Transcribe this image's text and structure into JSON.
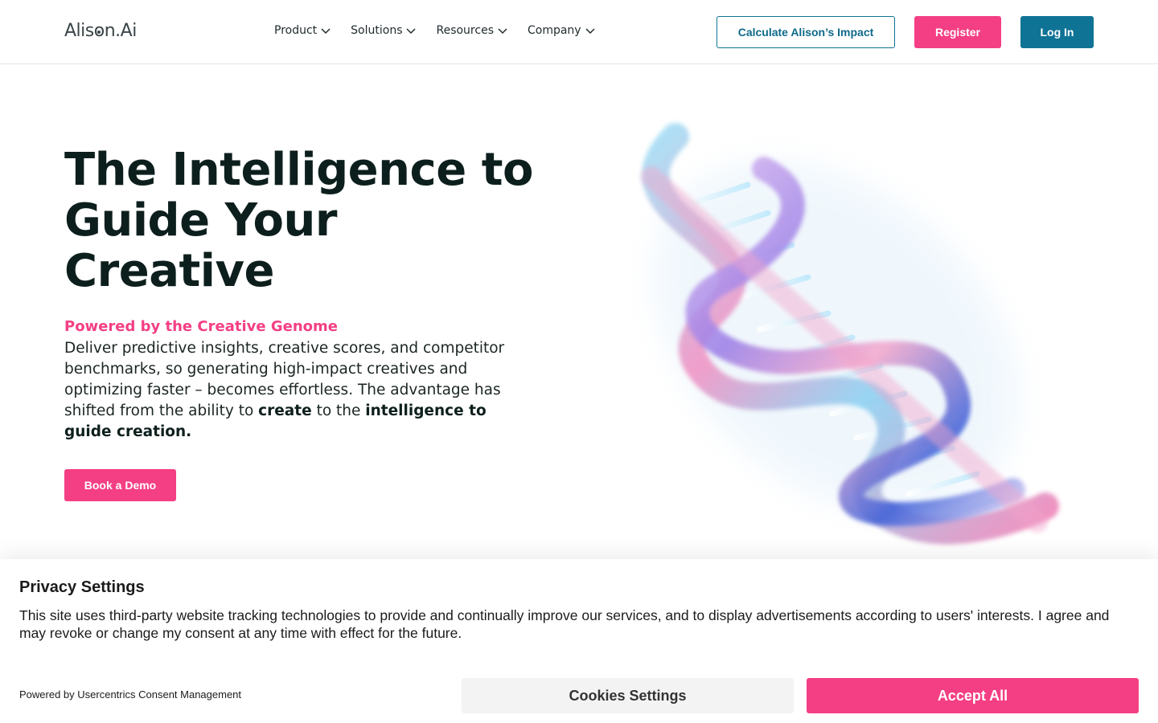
{
  "header": {
    "logo_prefix": "Alis",
    "logo_o": "o",
    "logo_suffix": "n.Ai",
    "nav": [
      {
        "label": "Product"
      },
      {
        "label": "Solutions"
      },
      {
        "label": "Resources"
      },
      {
        "label": "Company"
      }
    ],
    "calculate_label": "Calculate Alison’s Impact",
    "register_label": "Register",
    "login_label": "Log In"
  },
  "hero": {
    "title": "The Intelligence to Guide Your Creative",
    "subtitle": "Powered by the Creative Genome",
    "body_part1": "Deliver predictive insights, creative scores, and competitor benchmarks, so generating high-impact creatives and optimizing faster – becomes effortless. The advantage has shifted from the ability to ",
    "body_bold1": "create",
    "body_part2": " to the ",
    "body_bold2": "intelligence to guide creation.",
    "demo_label": "Book a Demo"
  },
  "privacy": {
    "title": "Privacy Settings",
    "text": "This site uses third-party website tracking technologies to provide and continually improve our services, and to display advertisements according to users' interests. I agree and may revoke or change my consent at any time with effect for the future.",
    "powered": "Powered by Usercentrics Consent Management",
    "cookies_label": "Cookies Settings",
    "accept_label": "Accept All"
  },
  "colors": {
    "brand_pink": "#f43f84",
    "brand_teal": "#0f7395",
    "heading": "#0d1f1d"
  },
  "icons": {
    "nav_dropdown": "chevron-down-icon",
    "hero_image": "dna-helix-illustration"
  }
}
